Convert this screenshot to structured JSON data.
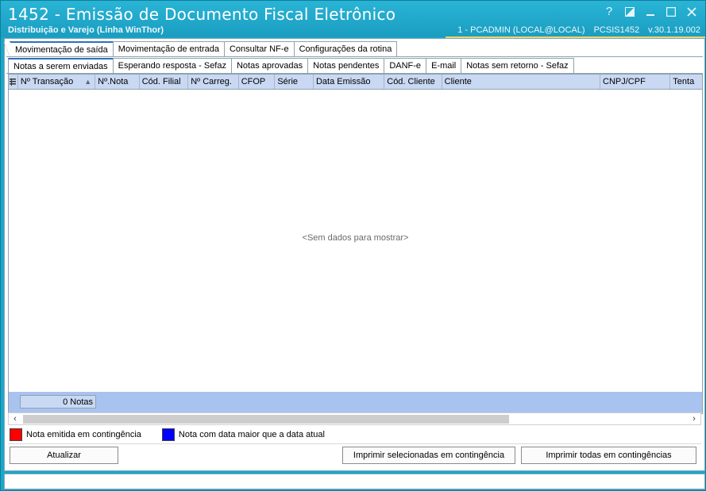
{
  "window": {
    "title": "1452 - Emissão de Documento Fiscal Eletrônico",
    "subtitle": "Distribuição e Varejo (Linha WinThor)",
    "session_user": "1 - PCADMIN (LOCAL@LOCAL)",
    "session_module": "PCSIS1452",
    "session_version": "v.30.1.19.002",
    "buttons": {
      "help": "?",
      "restore": "restore-icon",
      "minimize": "minimize-icon",
      "maximize": "maximize-icon",
      "close": "close-icon"
    }
  },
  "main_tabs": [
    {
      "label": "Movimentação de saída",
      "active": true
    },
    {
      "label": "Movimentação de entrada",
      "active": false
    },
    {
      "label": "Consultar NF-e",
      "active": false
    },
    {
      "label": "Configurações da rotina",
      "active": false
    }
  ],
  "sub_tabs": [
    {
      "label": "Notas a serem enviadas",
      "active": true
    },
    {
      "label": "Esperando resposta - Sefaz",
      "active": false
    },
    {
      "label": "Notas aprovadas",
      "active": false
    },
    {
      "label": "Notas pendentes",
      "active": false
    },
    {
      "label": "DANF-e",
      "active": false
    },
    {
      "label": "E-mail",
      "active": false
    },
    {
      "label": "Notas sem retorno - Sefaz",
      "active": false
    }
  ],
  "grid": {
    "columns": [
      "Nº Transação",
      "Nº.Nota",
      "Cód. Filial",
      "Nº Carreg.",
      "CFOP",
      "Série",
      "Data Emissão",
      "Cód. Cliente",
      "Cliente",
      "CNPJ/CPF",
      "Tenta"
    ],
    "sort_indicator": "▲",
    "empty_text": "<Sem dados para mostrar>",
    "count_label": "0 Notas"
  },
  "legend": [
    {
      "label": "Nota emitida em contingência",
      "color": "#ff0000"
    },
    {
      "label": "Nota com data maior que a data atual",
      "color": "#0000ff"
    }
  ],
  "buttons": {
    "refresh": "Atualizar",
    "print_selected": "Imprimir selecionadas em contingência",
    "print_all": "Imprimir todas em contingências"
  }
}
